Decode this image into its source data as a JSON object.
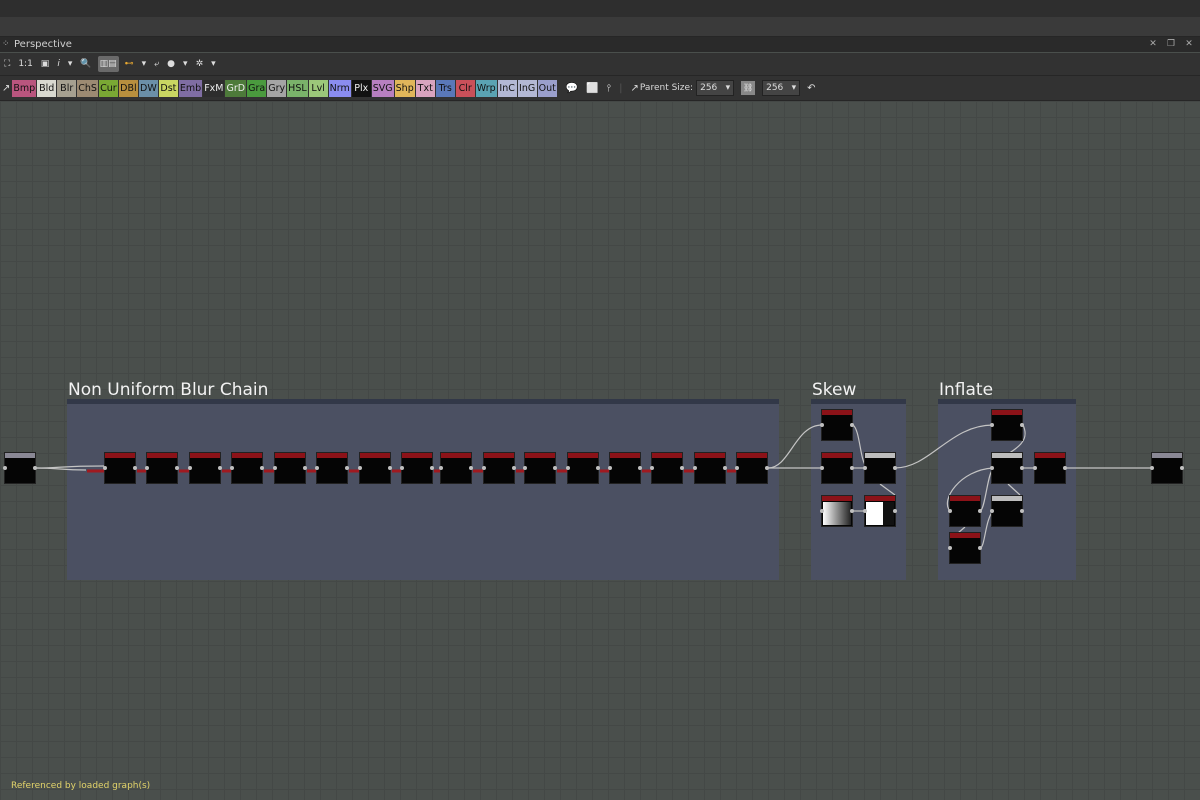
{
  "panel": {
    "title": "Perspective",
    "grip_icon": "grip-icon"
  },
  "toolbar1": {
    "zoom_label": "1:1",
    "info_label": "i"
  },
  "toolbar2": {
    "node_chips": [
      {
        "label": "Bmp",
        "color": "#b9557e"
      },
      {
        "label": "Bld",
        "color": "#d9d9d0"
      },
      {
        "label": "Blr",
        "color": "#a6a090"
      },
      {
        "label": "ChS",
        "color": "#9c8a72"
      },
      {
        "label": "Cur",
        "color": "#7aa834"
      },
      {
        "label": "DBl",
        "color": "#b88f3e"
      },
      {
        "label": "DW",
        "color": "#6b8fa8"
      },
      {
        "label": "Dst",
        "color": "#c9d662"
      },
      {
        "label": "Emb",
        "color": "#7f6da3"
      },
      {
        "label": "FxM",
        "color": "#2d2d2d",
        "dark": true
      },
      {
        "label": "GrD",
        "color": "#4d7a3a",
        "dark": true
      },
      {
        "label": "Gra",
        "color": "#4a9a3e"
      },
      {
        "label": "Gry",
        "color": "#a4a4a4"
      },
      {
        "label": "HSL",
        "color": "#7ab26a"
      },
      {
        "label": "Lvl",
        "color": "#9cc77a"
      },
      {
        "label": "Nrm",
        "color": "#8a8cf0"
      },
      {
        "label": "Plx",
        "color": "#111111",
        "dark": true
      },
      {
        "label": "SVG",
        "color": "#b77fc0"
      },
      {
        "label": "Shp",
        "color": "#e0b65a"
      },
      {
        "label": "Txt",
        "color": "#d9a4bf"
      },
      {
        "label": "Trs",
        "color": "#5a78b8"
      },
      {
        "label": "Clr",
        "color": "#c9505a"
      },
      {
        "label": "Wrp",
        "color": "#5aa3b3"
      },
      {
        "label": "InC",
        "color": "#b3b8d4"
      },
      {
        "label": "InG",
        "color": "#b3b8d4"
      },
      {
        "label": "Out",
        "color": "#9a9fcc"
      }
    ],
    "parent_size_label": "Parent Size:",
    "width_value": "256",
    "height_value": "256"
  },
  "frames": [
    {
      "title": "Non Uniform Blur Chain",
      "color": "#4b5062"
    },
    {
      "title": "Skew",
      "color": "#4b5062"
    },
    {
      "title": "Inflate",
      "color": "#4b5062"
    }
  ],
  "status": {
    "text": "Referenced by loaded graph(s)",
    "color": "#e2d36a"
  },
  "colors": {
    "node_header": "#8c1218",
    "canvas": "#4a4f4c"
  }
}
